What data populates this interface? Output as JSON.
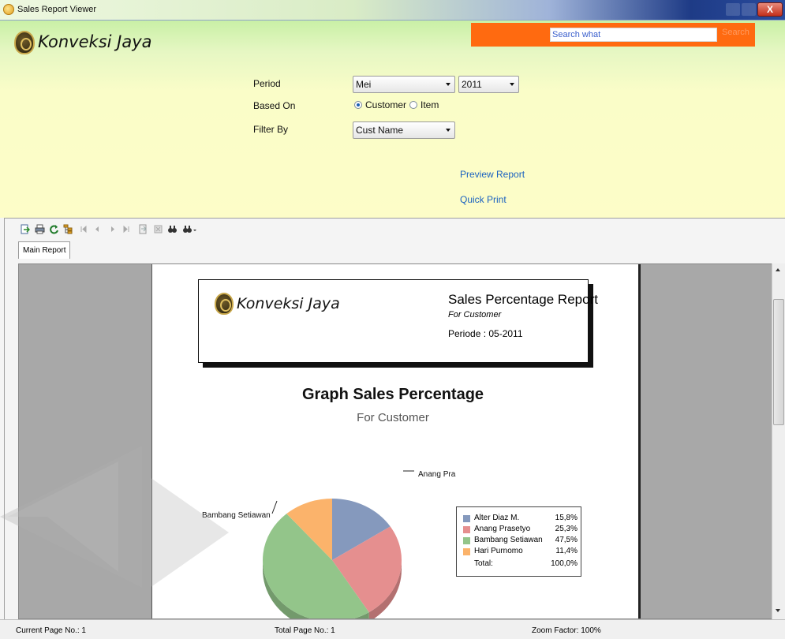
{
  "window": {
    "title": "Sales Report Viewer",
    "close_label": "X"
  },
  "brand": {
    "name": "Konveksi Jaya"
  },
  "search": {
    "placeholder": "Search what",
    "button_label": "Search"
  },
  "filters": {
    "period_label": "Period",
    "period_month": "Mei",
    "period_year": "2011",
    "based_on_label": "Based On",
    "based_on_options": [
      "Customer",
      "Item"
    ],
    "based_on_selected": "Customer",
    "filter_by_label": "Filter By",
    "filter_by_value": "Cust Name"
  },
  "actions": {
    "preview_label": "Preview Report",
    "quick_print_label": "Quick Print"
  },
  "viewer": {
    "toolbar_icons": [
      "export-icon",
      "print-icon",
      "refresh-icon",
      "group-tree-icon",
      "first-page-icon",
      "prev-page-icon",
      "next-page-icon",
      "last-page-icon",
      "goto-page-icon",
      "stop-icon",
      "find-icon",
      "zoom-icon"
    ],
    "tab_label": "Main Report"
  },
  "report": {
    "company": "Konveksi Jaya",
    "title": "Sales Percentage Report",
    "subtitle": "For Customer",
    "period": "Periode : 05-2011",
    "graph_title": "Graph Sales Percentage",
    "graph_subtitle": "For Customer"
  },
  "chart_data": {
    "type": "pie",
    "title": "Graph Sales Percentage",
    "subtitle": "For Customer",
    "legend_position": "right",
    "series": [
      {
        "name": "Alter Diaz M.",
        "value": 15.8,
        "display": "15,8%",
        "color": "#8599bd"
      },
      {
        "name": "Anang Prasetyo",
        "value": 25.3,
        "display": "25,3%",
        "color": "#e58f8f"
      },
      {
        "name": "Bambang Setiawan",
        "value": 47.5,
        "display": "47,5%",
        "color": "#93c58a"
      },
      {
        "name": "Hari Purnomo",
        "value": 11.4,
        "display": "11,4%",
        "color": "#fbb36b"
      }
    ],
    "total_label": "Total:",
    "total_value": "100,0%",
    "slice_labels": [
      {
        "text": "Alter Diaz M."
      },
      {
        "text": "Anang Pra"
      },
      {
        "text": "Bambang Setiawan"
      },
      {
        "text": "Hari Purnomo"
      }
    ]
  },
  "status": {
    "current_page": "Current Page No.: 1",
    "total_page": "Total Page No.: 1",
    "zoom": "Zoom Factor: 100%"
  }
}
